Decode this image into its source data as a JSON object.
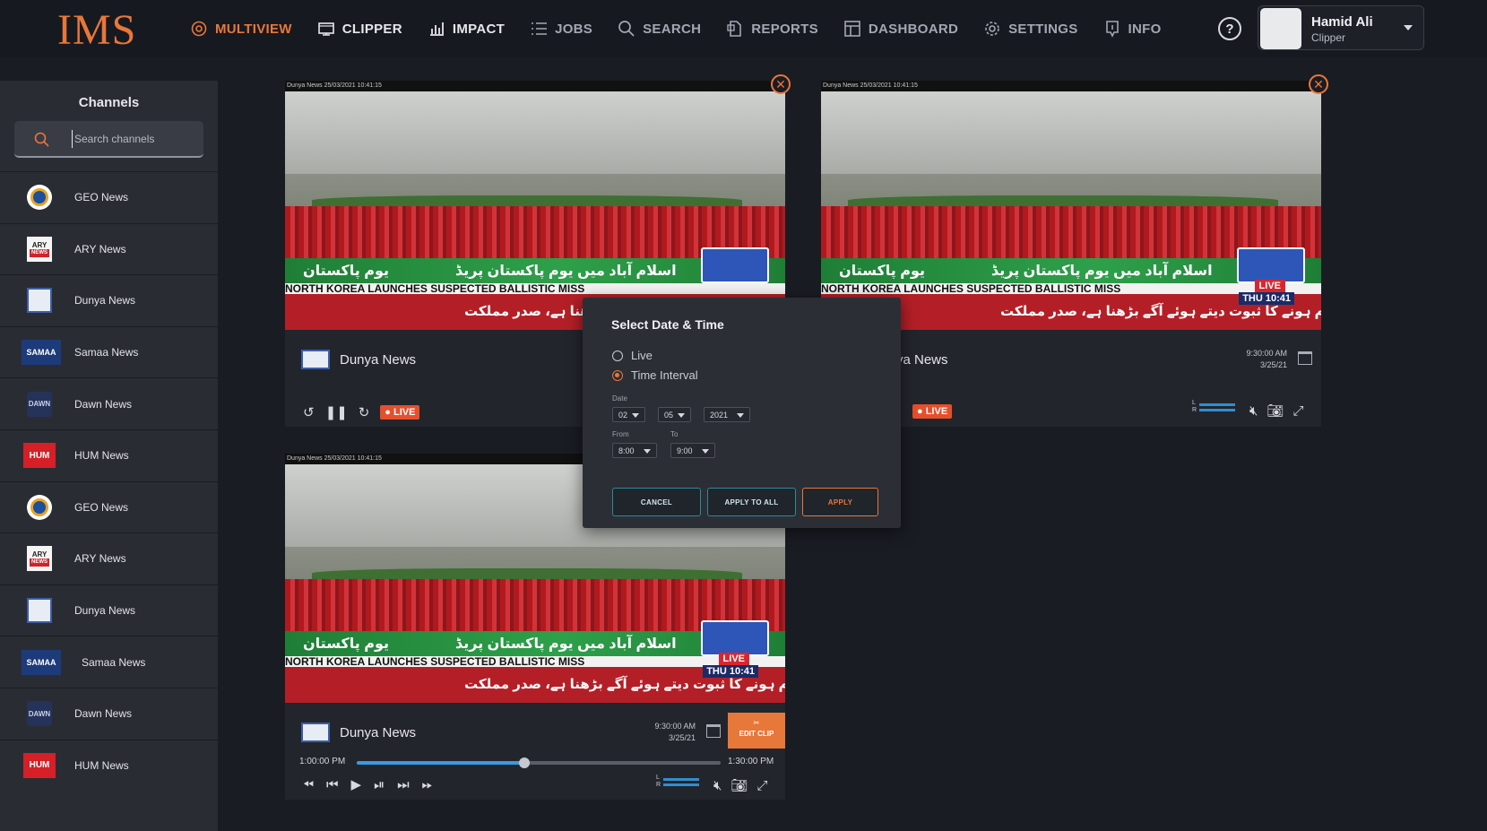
{
  "app": {
    "logo": "IMS"
  },
  "nav": {
    "items": [
      {
        "label": "MULTIVIEW",
        "icon": "multiview-icon"
      },
      {
        "label": "CLIPPER",
        "icon": "clipper-icon"
      },
      {
        "label": "IMPACT",
        "icon": "impact-chart-icon"
      },
      {
        "label": "JOBS",
        "icon": "jobs-list-icon"
      },
      {
        "label": "SEARCH",
        "icon": "search-icon"
      },
      {
        "label": "REPORTS",
        "icon": "reports-icon"
      },
      {
        "label": "DASHBOARD",
        "icon": "dashboard-icon"
      },
      {
        "label": "SETTINGS",
        "icon": "gear-icon"
      },
      {
        "label": "INFO",
        "icon": "info-icon"
      }
    ],
    "help": "?"
  },
  "user": {
    "name": "Hamid Ali",
    "role": "Clipper"
  },
  "sidebar": {
    "title": "Channels",
    "search_placeholder": "Search channels",
    "channels": [
      {
        "name": "GEO News"
      },
      {
        "name": "ARY News"
      },
      {
        "name": "Dunya News"
      },
      {
        "name": "Samaa News"
      },
      {
        "name": "Dawn News"
      },
      {
        "name": "HUM News"
      },
      {
        "name": "GEO News"
      },
      {
        "name": "ARY News"
      },
      {
        "name": "Dunya News"
      },
      {
        "name": "Samaa News"
      },
      {
        "name": "Dawn News"
      },
      {
        "name": "HUM News"
      }
    ],
    "logo_text": {
      "ary": "ARY",
      "ary_sub": "NEWS",
      "samaa": "SAMAA",
      "dawn": "DAWN",
      "hum": "HUM"
    }
  },
  "video": {
    "overlay_stamp": "Dunya News  25/03/2021 10:41:15",
    "urdu_left": "یوم پاکستان",
    "urdu_mid": "اسلام آباد میں یوم پاکستان پریڈ",
    "headline": "NORTH KOREA LAUNCHES SUSPECTED BALLISTIC MISS",
    "urdu_bottom": "ہمیں زندہ قوم ہونے کا ثبوت دیتے ہوئے آگے بڑھنا ہے، صدر مملکت",
    "live_tag": "LIVE",
    "clock": "THU 10:41"
  },
  "players": [
    {
      "title": "Dunya News",
      "live": "LIVE"
    },
    {
      "title": "ya News",
      "time": "9:30:00 AM",
      "date": "3/25/21",
      "live": "LIVE"
    },
    {
      "title": "Dunya News",
      "time": "9:30:00 AM",
      "date": "3/25/21",
      "edit_clip": "EDIT CLIP",
      "start": "1:00:00 PM",
      "end": "1:30:00 PM",
      "progress": 0.46
    }
  ],
  "modal": {
    "title": "Select Date & Time",
    "options": [
      "Live",
      "Time Interval"
    ],
    "selected": "Time Interval",
    "date_label": "Date",
    "day": "02",
    "month": "05",
    "year": "2021",
    "from_label": "From",
    "to_label": "To",
    "from": "8:00",
    "to": "9:00",
    "cancel": "CANCEL",
    "apply_all": "APPLY TO ALL",
    "apply": "APPLY"
  },
  "colors": {
    "accent": "#e8773a",
    "teal": "#2a8b9a",
    "progress": "#3a9be0",
    "live": "#e64f2b"
  }
}
